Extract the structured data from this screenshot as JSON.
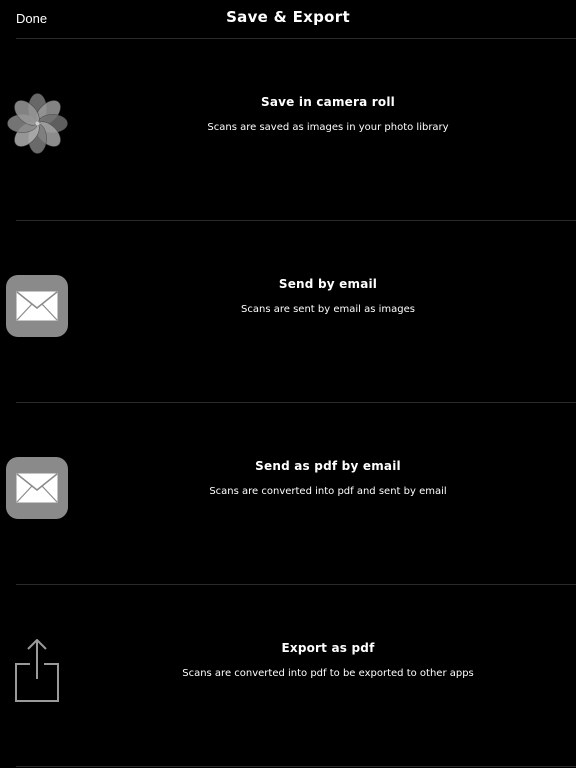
{
  "header": {
    "done_label": "Done",
    "title": "Save & Export"
  },
  "rows": [
    {
      "title": "Save in camera roll",
      "subtitle": "Scans are saved as images in your photo library",
      "icon": "photos-flower-icon"
    },
    {
      "title": "Send by email",
      "subtitle": "Scans are sent by email as images",
      "icon": "mail-icon"
    },
    {
      "title": "Send as pdf by email",
      "subtitle": "Scans are converted into pdf and sent by email",
      "icon": "mail-icon"
    },
    {
      "title": "Export as pdf",
      "subtitle": "Scans are converted into pdf to be exported to other apps",
      "icon": "share-icon"
    }
  ],
  "colors": {
    "background": "#000000",
    "text": "#ffffff",
    "separator": "#2a2a2a",
    "icon_gray": "#8a8a8a"
  }
}
